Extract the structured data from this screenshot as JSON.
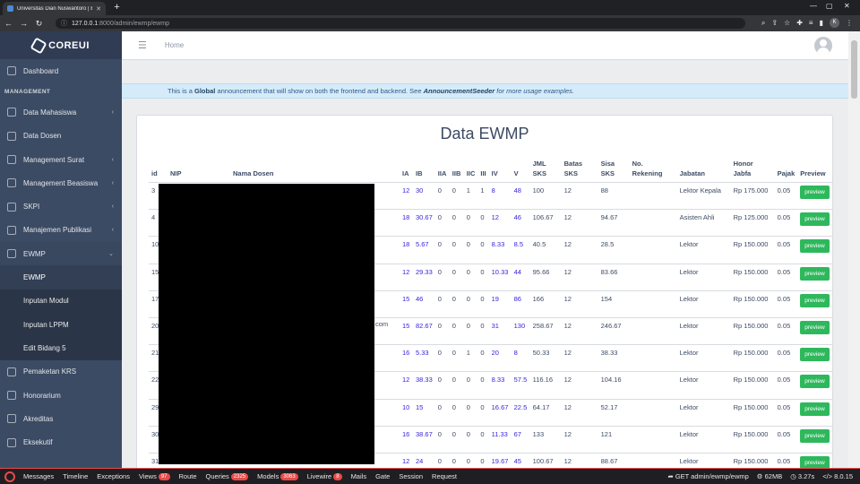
{
  "browser": {
    "tab_title": "Universitas Dian Nuswantoro | EWMP",
    "url_host": "127.0.0.1",
    "url_path": ":8000/admin/ewmp/ewmp",
    "profile_initial": "K"
  },
  "brand": {
    "name": "COREUI"
  },
  "sidebar": {
    "dashboard": "Dashboard",
    "section_title": "MANAGEMENT",
    "items": [
      {
        "label": "Data Mahasiswa",
        "has_children": true
      },
      {
        "label": "Data Dosen",
        "has_children": false
      },
      {
        "label": "Management Surat",
        "has_children": true
      },
      {
        "label": "Management Beasiswa",
        "has_children": true
      },
      {
        "label": "SKPI",
        "has_children": true
      },
      {
        "label": "Manajemen Publikasi",
        "has_children": true
      },
      {
        "label": "EWMP",
        "has_children": true,
        "open": true
      }
    ],
    "ewmp_children": [
      "EWMP",
      "Inputan Modul",
      "Inputan LPPM",
      "Edit Bidang 5"
    ],
    "after_items": [
      "Pemaketan KRS",
      "Honorarium",
      "Akreditas",
      "Eksekutif"
    ]
  },
  "header": {
    "breadcrumb": "Home"
  },
  "announcement": {
    "prefix": "This is a ",
    "bold": "Global",
    "middle": " announcement that will show on both the frontend and backend. See ",
    "italic_bold": "AnnouncementSeeder",
    "suffix": " for more usage examples."
  },
  "page": {
    "title": "Data EWMP"
  },
  "table": {
    "headers": [
      "id",
      "NIP",
      "Nama Dosen",
      "IA",
      "IB",
      "IIA",
      "IIB",
      "IIC",
      "III",
      "IV",
      "V",
      "JML SKS",
      "Batas SKS",
      "Sisa SKS",
      "No. Rekening",
      "Jabatan",
      "Honor Jabfa",
      "Pajak",
      "Preview"
    ],
    "rows": [
      {
        "id": "3",
        "ia": "12",
        "ib": "30",
        "iia": "0",
        "iib": "0",
        "iic": "1",
        "iii": "1",
        "iv": "8",
        "v": "48",
        "jml": "100",
        "batas": "12",
        "sisa": "88",
        "jabatan": "Lektor Kepala",
        "honor": "Rp 175.000",
        "pajak": "0.05"
      },
      {
        "id": "4",
        "ia": "18",
        "ib": "30.67",
        "iia": "0",
        "iib": "0",
        "iic": "0",
        "iii": "0",
        "iv": "12",
        "v": "46",
        "jml": "106.67",
        "batas": "12",
        "sisa": "94.67",
        "jabatan": "Asisten Ahli",
        "honor": "Rp 125.000",
        "pajak": "0.05"
      },
      {
        "id": "10",
        "ia": "18",
        "ib": "5.67",
        "iia": "0",
        "iib": "0",
        "iic": "0",
        "iii": "0",
        "iv": "8.33",
        "v": "8.5",
        "jml": "40.5",
        "batas": "12",
        "sisa": "28.5",
        "jabatan": "Lektor",
        "honor": "Rp 150.000",
        "pajak": "0.05"
      },
      {
        "id": "15",
        "ia": "12",
        "ib": "29.33",
        "iia": "0",
        "iib": "0",
        "iic": "0",
        "iii": "0",
        "iv": "10.33",
        "v": "44",
        "jml": "95.66",
        "batas": "12",
        "sisa": "83.66",
        "jabatan": "Lektor",
        "honor": "Rp 150.000",
        "pajak": "0.05"
      },
      {
        "id": "17",
        "ia": "15",
        "ib": "46",
        "iia": "0",
        "iib": "0",
        "iic": "0",
        "iii": "0",
        "iv": "19",
        "v": "86",
        "jml": "166",
        "batas": "12",
        "sisa": "154",
        "jabatan": "Lektor",
        "honor": "Rp 150.000",
        "pajak": "0.05"
      },
      {
        "id": "20",
        "ia": "15",
        "ib": "82.67",
        "iia": "0",
        "iib": "0",
        "iic": "0",
        "iii": "0",
        "iv": "31",
        "v": "130",
        "jml": "258.67",
        "batas": "12",
        "sisa": "246.67",
        "jabatan": "Lektor",
        "honor": "Rp 150.000",
        "pajak": "0.05"
      },
      {
        "id": "21",
        "ia": "16",
        "ib": "5.33",
        "iia": "0",
        "iib": "0",
        "iic": "1",
        "iii": "0",
        "iv": "20",
        "v": "8",
        "jml": "50.33",
        "batas": "12",
        "sisa": "38.33",
        "jabatan": "Lektor",
        "honor": "Rp 150.000",
        "pajak": "0.05"
      },
      {
        "id": "22",
        "ia": "12",
        "ib": "38.33",
        "iia": "0",
        "iib": "0",
        "iic": "0",
        "iii": "0",
        "iv": "8.33",
        "v": "57.5",
        "jml": "116.16",
        "batas": "12",
        "sisa": "104.16",
        "jabatan": "Lektor",
        "honor": "Rp 150.000",
        "pajak": "0.05"
      },
      {
        "id": "29",
        "ia": "10",
        "ib": "15",
        "iia": "0",
        "iib": "0",
        "iic": "0",
        "iii": "0",
        "iv": "16.67",
        "v": "22.5",
        "jml": "64.17",
        "batas": "12",
        "sisa": "52.17",
        "jabatan": "Lektor",
        "honor": "Rp 150.000",
        "pajak": "0.05"
      },
      {
        "id": "30",
        "ia": "16",
        "ib": "38.67",
        "iia": "0",
        "iib": "0",
        "iic": "0",
        "iii": "0",
        "iv": "11.33",
        "v": "67",
        "jml": "133",
        "batas": "12",
        "sisa": "121",
        "jabatan": "Lektor",
        "honor": "Rp 150.000",
        "pajak": "0.05"
      },
      {
        "id": "31",
        "ia": "12",
        "ib": "24",
        "iia": "0",
        "iib": "0",
        "iic": "0",
        "iii": "0",
        "iv": "19.67",
        "v": "45",
        "jml": "100.67",
        "batas": "12",
        "sisa": "88.67",
        "jabatan": "Lektor",
        "honor": "Rp 150.000",
        "pajak": "0.05"
      }
    ],
    "preview_label": "preview",
    "leak_text": "com"
  },
  "debugbar": {
    "items": [
      {
        "label": "Messages"
      },
      {
        "label": "Timeline"
      },
      {
        "label": "Exceptions"
      },
      {
        "label": "Views",
        "badge": "97"
      },
      {
        "label": "Route"
      },
      {
        "label": "Queries",
        "badge": "2325"
      },
      {
        "label": "Models",
        "badge": "3063"
      },
      {
        "label": "Livewire",
        "badge": "8"
      },
      {
        "label": "Mails"
      },
      {
        "label": "Gate"
      },
      {
        "label": "Session"
      },
      {
        "label": "Request"
      }
    ],
    "route": "GET admin/ewmp/ewmp",
    "memory": "62MB",
    "time": "3.27s",
    "php": "8.0.15"
  }
}
